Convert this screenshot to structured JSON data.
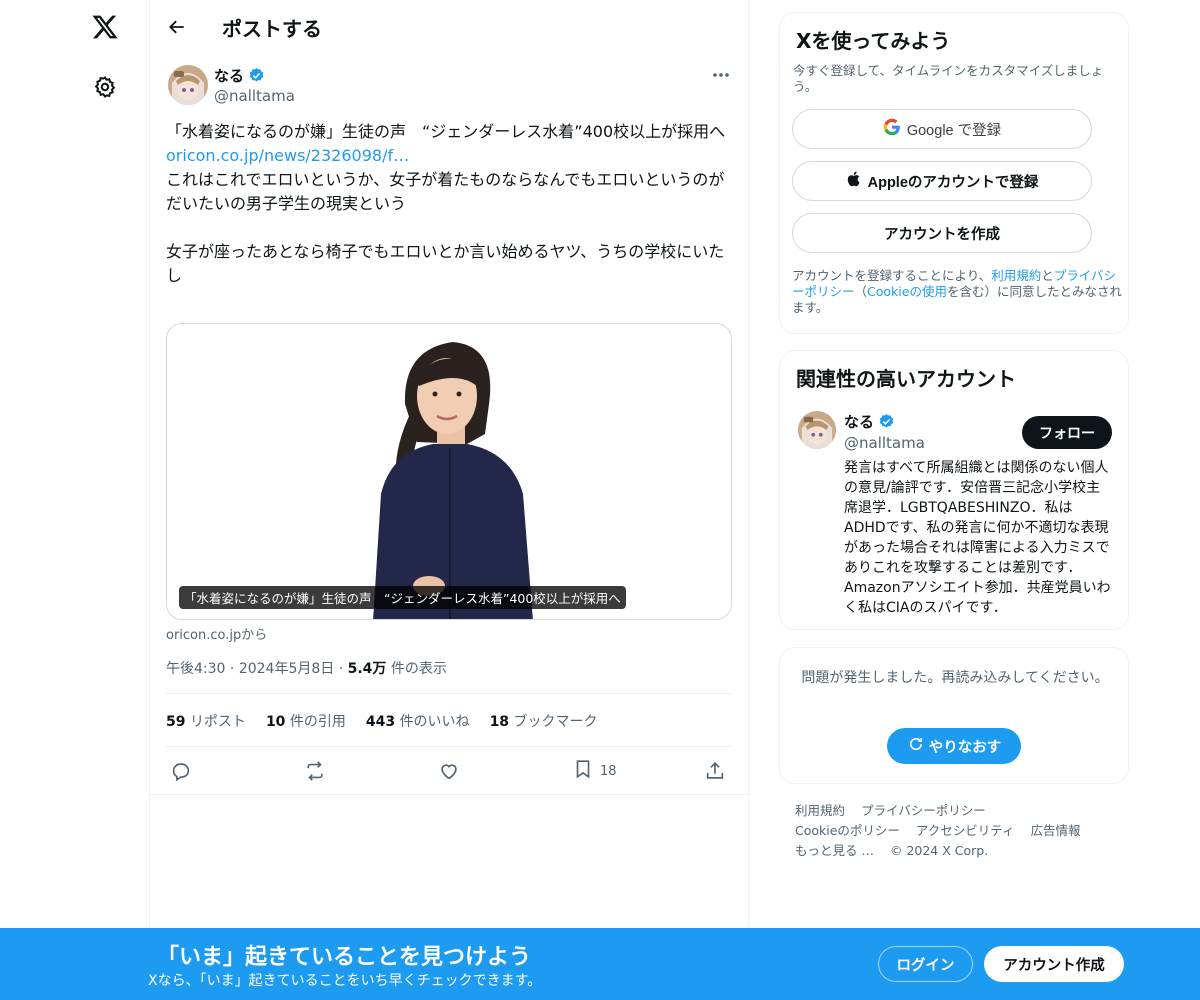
{
  "nav": {
    "logo_icon": "x-logo-icon",
    "settings_icon": "gear-icon"
  },
  "header": {
    "title": "ポストする"
  },
  "post": {
    "author_name": "なる",
    "author_handle": "@nalltama",
    "text_line1": "「水着姿になるのが嫌」生徒の声　“ジェンダーレス水着”400校以上が採用へ",
    "link": "oricon.co.jp/news/2326098/f…",
    "text_line2": "これはこれでエロいというか、女子が着たものならなんでもエロいというのがだいたいの男子学生の現実という",
    "text_line3": "女子が座ったあとなら椅子でもエロいとか言い始めるヤツ、うちの学校にいたし",
    "card_caption": "「水着姿になるのが嫌」生徒の声　“ジェンダーレス水着”400校以上が採用へ",
    "card_source": "oricon.co.jpから",
    "time": "午後4:30",
    "date": "2024年5月8日",
    "views_count": "5.4万",
    "views_label": "件の表示",
    "reposts_count": "59",
    "reposts_label": "リポスト",
    "quotes_count": "10",
    "quotes_label": "件の引用",
    "likes_count": "443",
    "likes_label": "件のいいね",
    "bookmarks_count": "18",
    "bookmarks_label": "ブックマーク",
    "bookmark_action_count": "18"
  },
  "signup_panel": {
    "title": "Xを使ってみよう",
    "subtitle": "今すぐ登録して、タイムラインをカスタマイズしましょう。",
    "google_label": "Google で登録",
    "apple_label": "Appleのアカウントで登録",
    "create_label": "アカウントを作成",
    "legal_prefix": "アカウントを登録することにより、",
    "legal_terms": "利用規約",
    "legal_and": "と",
    "legal_privacy": "プライバシーポリシー",
    "legal_open": "（",
    "legal_cookie": "Cookieの使用",
    "legal_suffix": "を含む）に同意したとみなされます。"
  },
  "related_panel": {
    "title": "関連性の高いアカウント",
    "name": "なる",
    "handle": "@nalltama",
    "follow_label": "フォロー",
    "bio": "発言はすべて所属組織とは関係のない個人の意見/論評です．安倍晋三記念小学校主席退学．LGBTQABESHINZO．私はADHDです、私の発言に何か不適切な表現があった場合それは障害による入力ミスでありこれを攻撃することは差別です．Amazonアソシエイト参加．共産党員いわく私はCIAのスパイです．"
  },
  "error_panel": {
    "message": "問題が発生しました。再読み込みしてください。",
    "retry_label": "やりなおす"
  },
  "footer": {
    "terms": "利用規約",
    "privacy": "プライバシーポリシー",
    "cookie": "Cookieのポリシー",
    "accessibility": "アクセシビリティ",
    "ads": "広告情報",
    "more": "もっと見る …",
    "copyright": "© 2024 X Corp."
  },
  "banner": {
    "title": "「いま」起きていることを見つけよう",
    "subtitle": "Xなら、「いま」起きていることをいち早くチェックできます。",
    "login_label": "ログイン",
    "signup_label": "アカウント作成"
  },
  "colors": {
    "accent": "#1d9bf0",
    "text": "#0f1419",
    "muted": "#536471"
  }
}
